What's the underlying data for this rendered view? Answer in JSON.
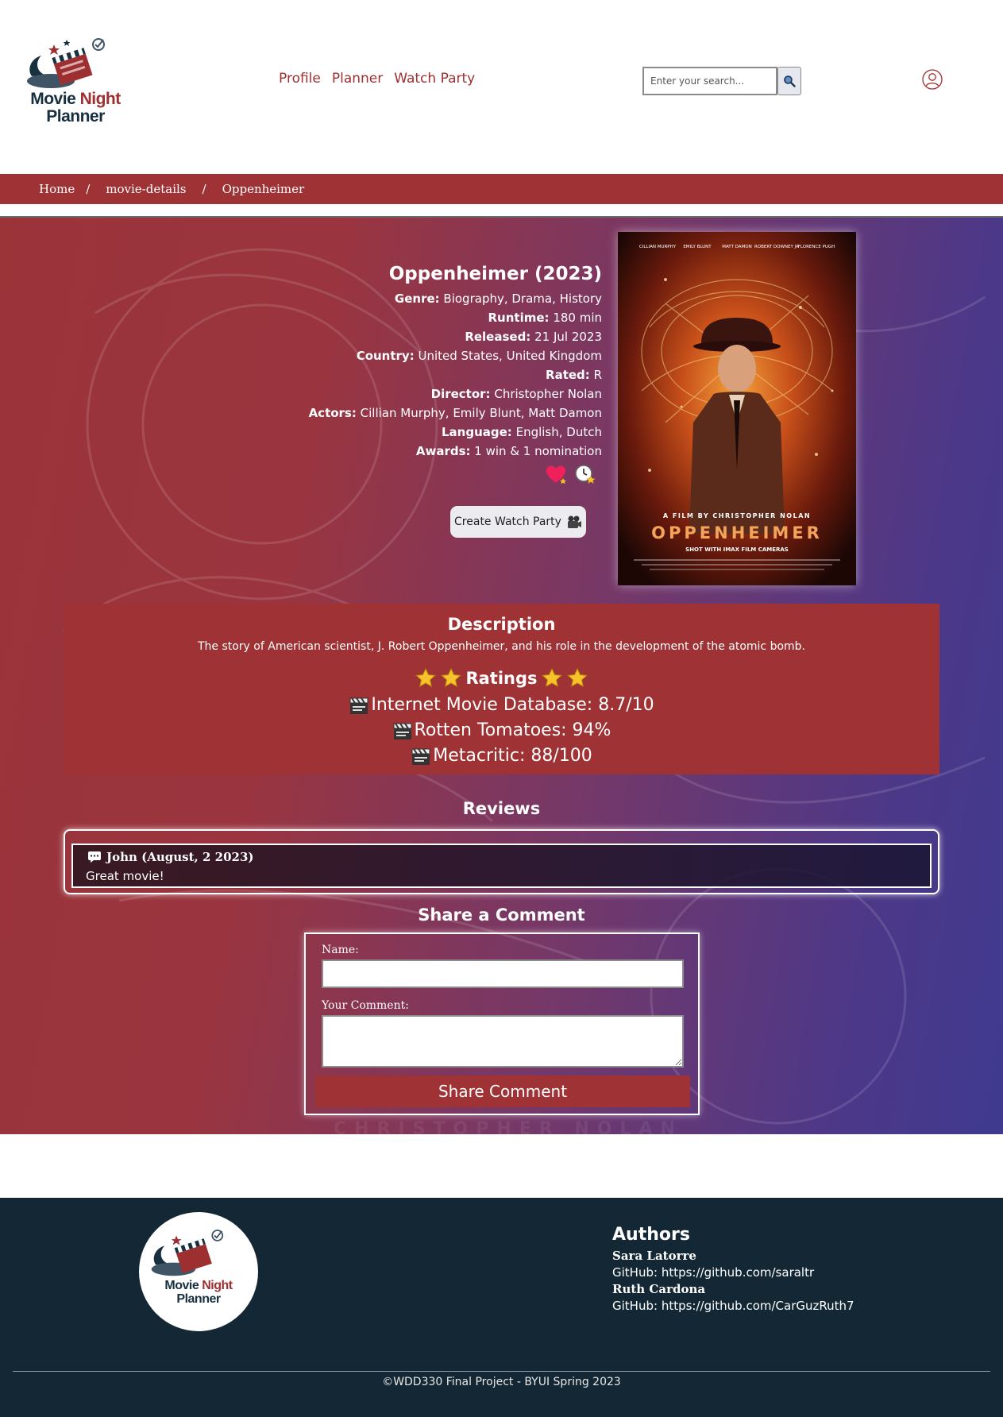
{
  "brand": {
    "line1": "Movie",
    "line1_accent": "Night",
    "line2": "Planner",
    "accent_color": "#9e2f31",
    "dark_color": "#17303f"
  },
  "nav": {
    "items": [
      {
        "label": "Profile"
      },
      {
        "label": "Planner"
      },
      {
        "label": "Watch Party"
      }
    ]
  },
  "search": {
    "placeholder": "Enter your search...",
    "button_icon": "search-icon"
  },
  "breadcrumb": {
    "items": [
      {
        "label": "Home"
      },
      {
        "label": "movie-details"
      },
      {
        "label": "Oppenheimer"
      }
    ],
    "separator": "/"
  },
  "movie": {
    "title": "Oppenheimer (2023)",
    "fields": [
      {
        "label": "Genre:",
        "value": "Biography, Drama, History"
      },
      {
        "label": "Runtime:",
        "value": "180 min"
      },
      {
        "label": "Released:",
        "value": "21 Jul 2023"
      },
      {
        "label": "Country:",
        "value": "United States, United Kingdom"
      },
      {
        "label": "Rated:",
        "value": "R"
      },
      {
        "label": "Director:",
        "value": "Christopher Nolan"
      },
      {
        "label": "Actors:",
        "value": "Cillian Murphy, Emily Blunt, Matt Damon"
      },
      {
        "label": "Language:",
        "value": "English, Dutch"
      },
      {
        "label": "Awards:",
        "value": "1 win & 1 nomination"
      }
    ],
    "watch_party_button": "Create Watch Party",
    "poster": {
      "credits": [
        "CILLIAN MURPHY",
        "EMILY BLUNT",
        "MATT DAMON",
        "ROBERT DOWNEY JR",
        "FLORENCE PUGH"
      ],
      "tagline": "A FILM BY CHRISTOPHER NOLAN",
      "title": "OPPENHEIMER",
      "subtitle": "SHOT WITH IMAX FILM CAMERAS"
    }
  },
  "description": {
    "title": "Description",
    "text": "The story of American scientist, J. Robert Oppenheimer, and his role in the development of the atomic bomb."
  },
  "ratings": {
    "title": "Ratings",
    "items": [
      {
        "text": "Internet Movie Database: 8.7/10"
      },
      {
        "text": "Rotten Tomatoes: 94%"
      },
      {
        "text": "Metacritic: 88/100"
      }
    ]
  },
  "reviews": {
    "title": "Reviews",
    "items": [
      {
        "author": "John (August, 2 2023)",
        "text": "Great movie!"
      }
    ]
  },
  "share": {
    "title": "Share a Comment",
    "name_label": "Name:",
    "comment_label": "Your Comment:",
    "button": "Share Comment"
  },
  "hero": {
    "watermark": "CHRISTOPHER NOLAN"
  },
  "footer": {
    "authors_title": "Authors",
    "authors": [
      {
        "name": "Sara Latorre",
        "gh_label": "GitHub:",
        "gh_url": "https://github.com/saraltr"
      },
      {
        "name": "Ruth Cardona",
        "gh_label": "GitHub:",
        "gh_url": "https://github.com/CarGuzRuth7"
      }
    ],
    "copyright": "©WDD330 Final Project - BYUI Spring 2023"
  }
}
